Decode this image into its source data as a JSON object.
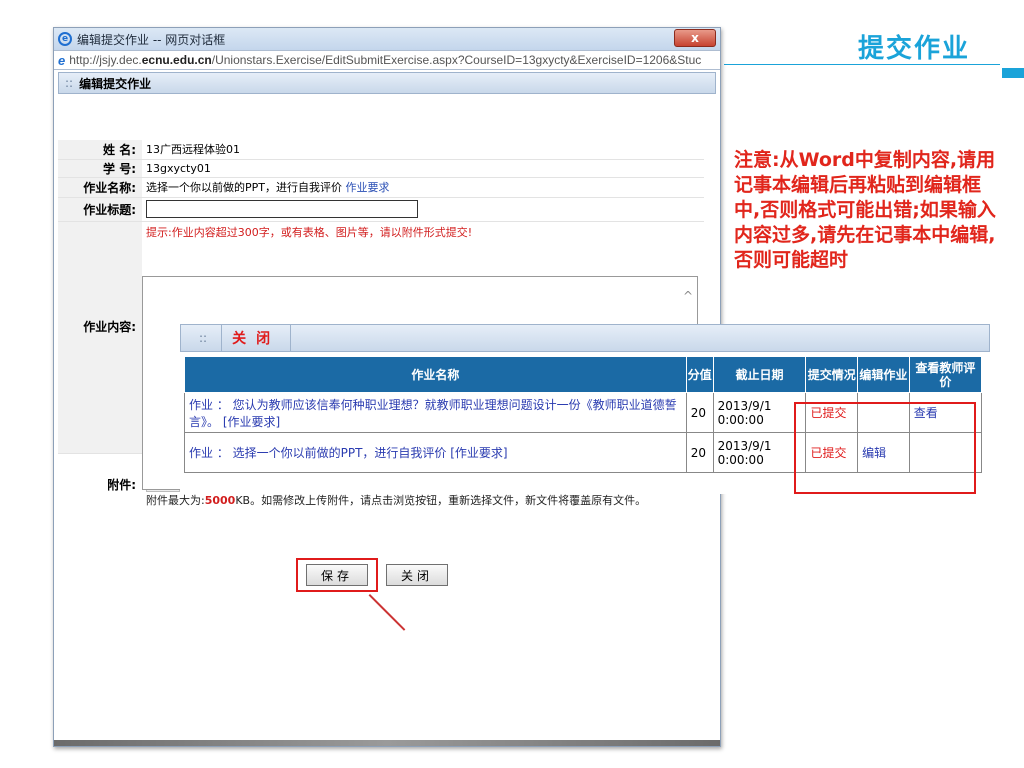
{
  "slide": {
    "title": "提交作业",
    "notice": "注意:从Word中复制内容,请用记事本编辑后再粘贴到编辑框中,否则格式可能出错;如果输入内容过多,请先在记事本中编辑,否则可能超时",
    "accent_color": "#1aa3d9",
    "notice_color": "#e1261c"
  },
  "dialog": {
    "window_title": "编辑提交作业 -- 网页对话框",
    "close_glyph": "x",
    "url_pre": "http://jsjy.dec.",
    "url_bold": "ecnu.edu.cn",
    "url_post": "/Unionstars.Exercise/EditSubmitExercise.aspx?CourseID=13gxycty&ExerciseID=1206&Stuc",
    "panel_title": "编辑提交作业",
    "panel_dots": "::",
    "form": {
      "name_label": "姓  名:",
      "name_value": "13广西远程体验01",
      "id_label": "学  号:",
      "id_value": "13gxycty01",
      "hw_name_label": "作业名称:",
      "hw_name_value": "选择一个你以前做的PPT，进行自我评价",
      "hw_requirement_link": "作业要求",
      "hw_title_label": "作业标题:",
      "hw_title_value": "",
      "hint": "提示:作业内容超过300字，或有表格、图片等，请以附件形式提交!",
      "content_label": "作业内容:",
      "attach_label": "附件:",
      "attach_note_pre": "附件最大为:",
      "attach_max": "5000",
      "attach_note_post": "KB。如需修改上传附件，请点击浏览按钮，重新选择文件，新文件将覆盖原有文件。"
    },
    "buttons": {
      "save": "保存",
      "close": "关闭"
    }
  },
  "popup": {
    "dots": "::",
    "close_label": "关闭",
    "columns": [
      "作业名称",
      "分值",
      "截止日期",
      "提交情况",
      "编辑作业",
      "查看教师评价"
    ],
    "rows": [
      {
        "name": "作业 ： 您认为教师应该信奉何种职业理想？就教师职业理想问题设计一份《教师职业道德誓言》。 [作业要求]",
        "score": "20",
        "deadline": "2013/9/1 0:00:00",
        "status": "已提交",
        "edit": "",
        "view": "查看"
      },
      {
        "name": "作业 ： 选择一个你以前做的PPT，进行自我评价 [作业要求]",
        "score": "20",
        "deadline": "2013/9/1 0:00:00",
        "status": "已提交",
        "edit": "编辑",
        "view": ""
      }
    ]
  }
}
